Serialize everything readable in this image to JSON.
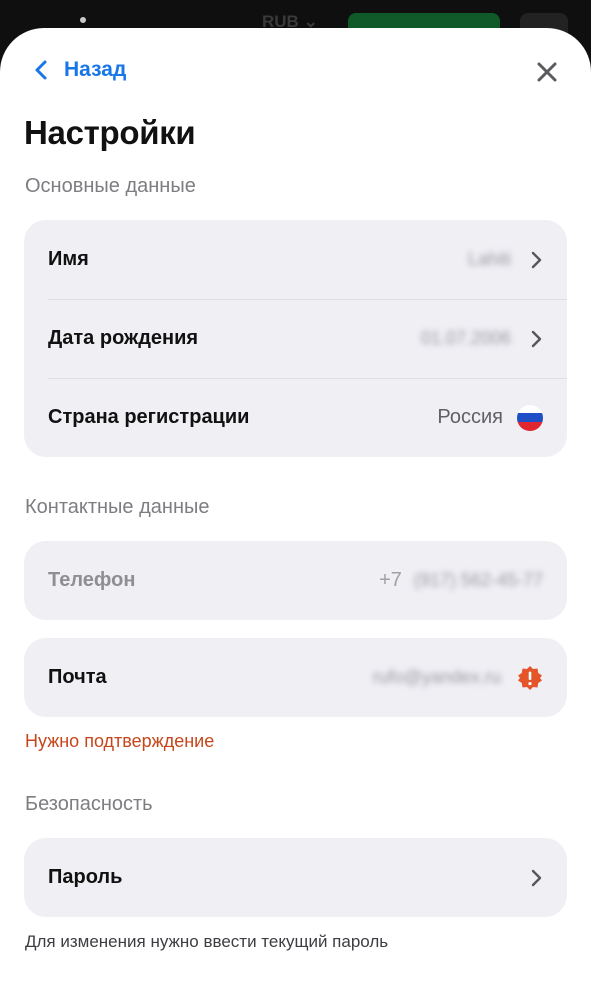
{
  "background": {
    "currency": "RUB"
  },
  "nav": {
    "back_label": "Назад"
  },
  "page_title": "Настройки",
  "basic": {
    "section_title": "Основные данные",
    "rows": [
      {
        "label": "Имя",
        "value": "Lahiti"
      },
      {
        "label": "Дата рождения",
        "value": "01.07.2006"
      },
      {
        "label": "Страна регистрации",
        "value": "Россия"
      }
    ]
  },
  "contacts": {
    "section_title": "Контактные данные",
    "phone": {
      "label": "Телефон",
      "prefix": "+7",
      "value": "(917) 562-45-77"
    },
    "email": {
      "label": "Почта",
      "value": "rufo@yandex.ru"
    },
    "warning": "Нужно подтверждение"
  },
  "security": {
    "section_title": "Безопасность",
    "password_label": "Пароль",
    "hint": "Для изменения нужно ввести текущий пароль"
  },
  "colors": {
    "accent": "#1976e8",
    "warning": "#c6461b",
    "warning_badge": "#e4552a",
    "card_bg": "#efeff4",
    "section_text": "#7d7d82"
  }
}
